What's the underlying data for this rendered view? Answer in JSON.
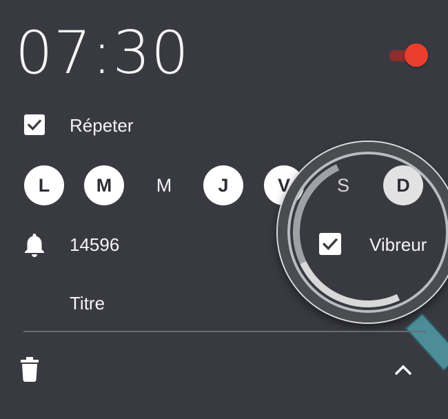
{
  "alarm": {
    "time": "07:30",
    "enabled": true,
    "repeat_label": "Répeter",
    "repeat_checked": true,
    "days": [
      {
        "label": "L",
        "selected": true
      },
      {
        "label": "M",
        "selected": true
      },
      {
        "label": "M",
        "selected": false
      },
      {
        "label": "J",
        "selected": true
      },
      {
        "label": "V",
        "selected": true
      },
      {
        "label": "S",
        "selected": false
      },
      {
        "label": "D",
        "selected": true
      }
    ],
    "ringtone": "14596",
    "vibrate_label": "Vibreur",
    "vibrate_checked": true,
    "title_placeholder": "Titre"
  },
  "icons": {
    "bell": "bell-icon",
    "trash": "trash-icon",
    "collapse": "chevron-up-icon",
    "check": "check-icon"
  },
  "colors": {
    "background": "#393a41",
    "accent": "#ea3f2e",
    "toggle_track": "#8f2d2d"
  }
}
